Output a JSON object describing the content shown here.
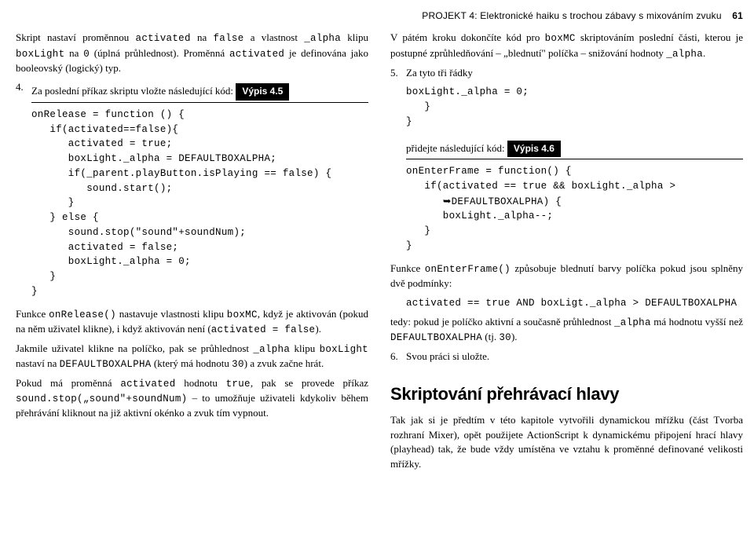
{
  "header": {
    "running_title": "PROJEKT 4: Elektronické haiku s trochou zábavy s mixováním zvuku",
    "page_number": "61"
  },
  "left": {
    "p1_a": "Skript nastaví proměnnou ",
    "p1_code1": "activated",
    "p1_b": " na ",
    "p1_code2": "false",
    "p1_c": " a vlastnost ",
    "p1_code3": "_alpha",
    "p1_d": " klipu ",
    "p1_code4": "boxLight",
    "p1_e": " na ",
    "p1_code5": "0",
    "p1_f": " (úplná průhlednost). Proměnná ",
    "p1_code6": "activated",
    "p1_g": " je definována jako booleovský (logický) typ.",
    "step4_num": "4.",
    "step4_text": "Za poslední příkaz skriptu vložte následující kód:",
    "listing_label": "Výpis 4.5",
    "code": "onRelease = function () {\n   if(activated==false){\n      activated = true;\n      boxLight._alpha = DEFAULTBOXALPHA;\n      if(_parent.playButton.isPlaying == false) {\n         sound.start();\n      }\n   } else {\n      sound.stop(\"sound\"+soundNum);\n      activated = false;\n      boxLight._alpha = 0;\n   }\n}",
    "p2_a": "Funkce ",
    "p2_code1": "onRelease()",
    "p2_b": " nastavuje vlastnosti klipu ",
    "p2_code2": "boxMC",
    "p2_c": ", když je aktivován (pokud na něm uživatel klikne), i když aktivován není (",
    "p2_code3": "activated = false",
    "p2_d": ").",
    "p3_a": "Jakmile uživatel klikne na políčko, pak se průhlednost ",
    "p3_code1": "_alpha",
    "p3_b": " klipu ",
    "p3_code2": "boxLight",
    "p3_c": " nastaví na ",
    "p3_code3": "DEFAULTBOXALPHA",
    "p3_d": " (který má hodnotu ",
    "p3_code4": "30",
    "p3_e": ") a zvuk začne hrát.",
    "p4_a": "Pokud má proměnná ",
    "p4_code1": "activated",
    "p4_b": " hodnotu ",
    "p4_code2": "true",
    "p4_c": ", pak se provede příkaz ",
    "p4_code3": "sound.stop(„sound\"+soundNum)",
    "p4_d": " – to umožňuje uživateli kdykoliv během přehrávání kliknout na již aktivní okénko a zvuk tím vypnout."
  },
  "right": {
    "p1_a": "V pátém kroku dokončíte kód pro ",
    "p1_code1": "boxMC",
    "p1_b": " skriptováním poslední části, kterou je postupné zprůhledňování – „blednutí\" políčka – snižování hodnoty ",
    "p1_code2": "_alpha",
    "p1_c": ".",
    "step5_num": "5.",
    "step5_text": "Za tyto tři řádky",
    "code5": "boxLight._alpha = 0;\n   }\n}",
    "step5_after": "přidejte následující kód:",
    "listing_label": "Výpis 4.6",
    "code6_l1": "onEnterFrame = function() {",
    "code6_l2": "   if(activated == true && boxLight._alpha >",
    "code6_arrow": "➥",
    "code6_l2b": "DEFAULTBOXALPHA) {",
    "code6_l3": "      boxLight._alpha--;",
    "code6_l4": "   }",
    "code6_l5": "}",
    "p2_a": "Funkce ",
    "p2_code1": "onEnterFrame()",
    "p2_b": " způsobuje blednutí barvy políčka pokud jsou splněny dvě podmínky:",
    "condline": "activated == true AND boxLigt._alpha > DEFAULTBOXALPHA",
    "p3_a": "tedy: pokud je políčko aktivní a současně průhlednost ",
    "p3_code1": "_alpha",
    "p3_b": " má hodnotu vyšší než ",
    "p3_code2": "DEFAULTBOXALPHA",
    "p3_c": " (tj. ",
    "p3_code3": "30",
    "p3_d": ").",
    "step6_num": "6.",
    "step6_text": "Svou práci si uložte.",
    "h2": "Skriptování přehrávací hlavy",
    "p4": "Tak jak si je předtím v této kapitole vytvořili dynamickou mřížku (část Tvorba rozhraní Mixer), opět použijete ActionScript k dynamickému připojení hrací hlavy (playhead) tak, že bude vždy umístěna ve vztahu k proměnné definované velikosti mřížky."
  }
}
